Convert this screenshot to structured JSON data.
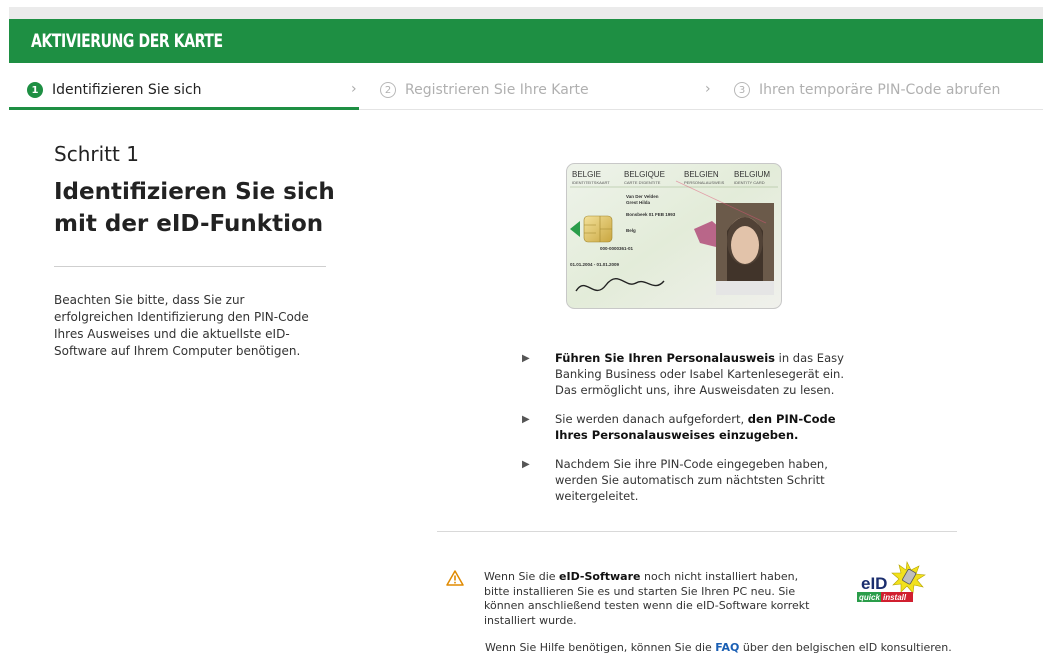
{
  "header": {
    "title": "AKTIVIERUNG DER KARTE"
  },
  "steps": [
    {
      "num": "1",
      "label": "Identifizieren Sie sich",
      "active": true
    },
    {
      "num": "2",
      "label": "Registrieren Sie Ihre Karte",
      "active": false
    },
    {
      "num": "3",
      "label": "Ihren temporäre PIN-Code abrufen",
      "active": false
    }
  ],
  "main": {
    "step_label": "Schritt 1",
    "title": "Identifizieren Sie sich mit der eID-Funktion",
    "note": "Beachten Sie bitte, dass Sie zur erfolgreichen Identifizierung den PIN-Code Ihres Ausweises und die aktuellste eID-Software auf Ihrem Computer benötigen."
  },
  "card": {
    "countries": [
      "BELGIE",
      "BELGIQUE",
      "BELGIEN",
      "BELGIUM"
    ],
    "subtitles": [
      "IDENTITEITSKAART",
      "CARTE D'IDENTITE",
      "PERSONALAUSWEIS",
      "IDENTITY CARD"
    ],
    "name": "Van Der Velden",
    "firstname": "Grest Hilda",
    "birth": "Bonsbeek 01 FEB 1993",
    "nationality": "Belg",
    "card_no": "000-0000361-01",
    "validity": "01.01.2004 - 01.01.2009",
    "signature": "Horwal"
  },
  "bullets": [
    {
      "bold_lead": "Führen Sie Ihren Personalausweis",
      "text": " in das Easy Banking Business oder Isabel Kartenlesegerät ein. Das ermöglicht uns, ihre Ausweisdaten zu lesen."
    },
    {
      "lead": "Sie werden danach aufgefordert, ",
      "bold_tail": "den PIN-Code Ihres Personalausweises einzugeben."
    },
    {
      "text": "Nachdem Sie ihre PIN-Code eingegeben haben, werden Sie automatisch zum nächtsten Schritt weitergeleitet."
    }
  ],
  "warning": {
    "lead": "Wenn Sie die ",
    "bold": "eID-Software",
    "tail": " noch nicht installiert haben, bitte installieren Sie es und starten Sie Ihren PC neu. Sie können anschließend testen wenn die eID-Software korrekt installiert wurde."
  },
  "help": {
    "lead": "Wenn Sie Hilfe benötigen, können Sie die ",
    "link": "FAQ",
    "tail": " über den belgischen eID konsultieren."
  },
  "eid_logo": {
    "top": "eID",
    "bottom_left": "quick",
    "bottom_right": "install"
  },
  "colors": {
    "brand_green": "#1e8f43",
    "link_blue": "#1a5fb4",
    "warn_orange": "#e08a00"
  }
}
